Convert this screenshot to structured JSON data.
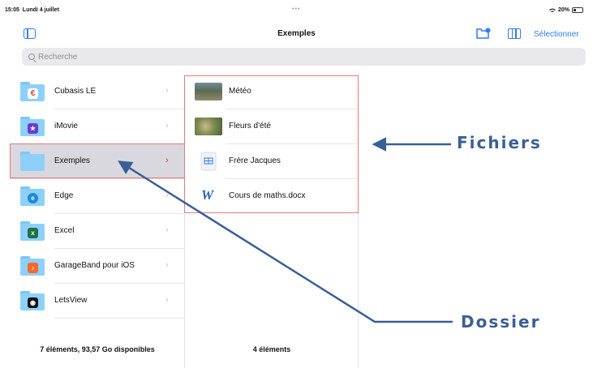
{
  "status": {
    "time": "15:05",
    "date": "Lundi 4 juillet",
    "dots": "•••",
    "wifi": "wifi-icon",
    "battery": "20%"
  },
  "navbar": {
    "title": "Exemples",
    "select": "Sélectionner"
  },
  "search": {
    "placeholder": "Recherche"
  },
  "column1": {
    "items": [
      {
        "label": "Cubasis LE",
        "icon": "cubasis-icon",
        "color": "#e33b3b"
      },
      {
        "label": "iMovie",
        "icon": "imovie-icon",
        "color": "#6a3ad8"
      },
      {
        "label": "Exemples",
        "icon": "folder-icon",
        "selected": true
      },
      {
        "label": "Edge",
        "icon": "edge-icon",
        "color": "#1e8ad6"
      },
      {
        "label": "Excel",
        "icon": "excel-icon",
        "color": "#1e7145"
      },
      {
        "label": "GarageBand pour iOS",
        "icon": "garageband-icon",
        "color": "#f36b2a"
      },
      {
        "label": "LetsView",
        "icon": "letsview-icon",
        "color": "#111111"
      }
    ],
    "footer": "7 éléments, 93,57 Go disponibles"
  },
  "column2": {
    "items": [
      {
        "label": "Météo",
        "icon": "photo-thumbnail"
      },
      {
        "label": "Fleurs d'été",
        "icon": "photo-thumbnail"
      },
      {
        "label": "Frère Jacques",
        "icon": "score-file-icon"
      },
      {
        "label": "Cours de maths.docx",
        "icon": "word-document-icon"
      }
    ],
    "footer": "4 éléments"
  },
  "annotations": {
    "files": "Fichiers",
    "folder": "Dossier"
  },
  "colors": {
    "accent": "#2f7cf6",
    "highlight": "#e97a7a",
    "annotation": "#3a5e98"
  }
}
